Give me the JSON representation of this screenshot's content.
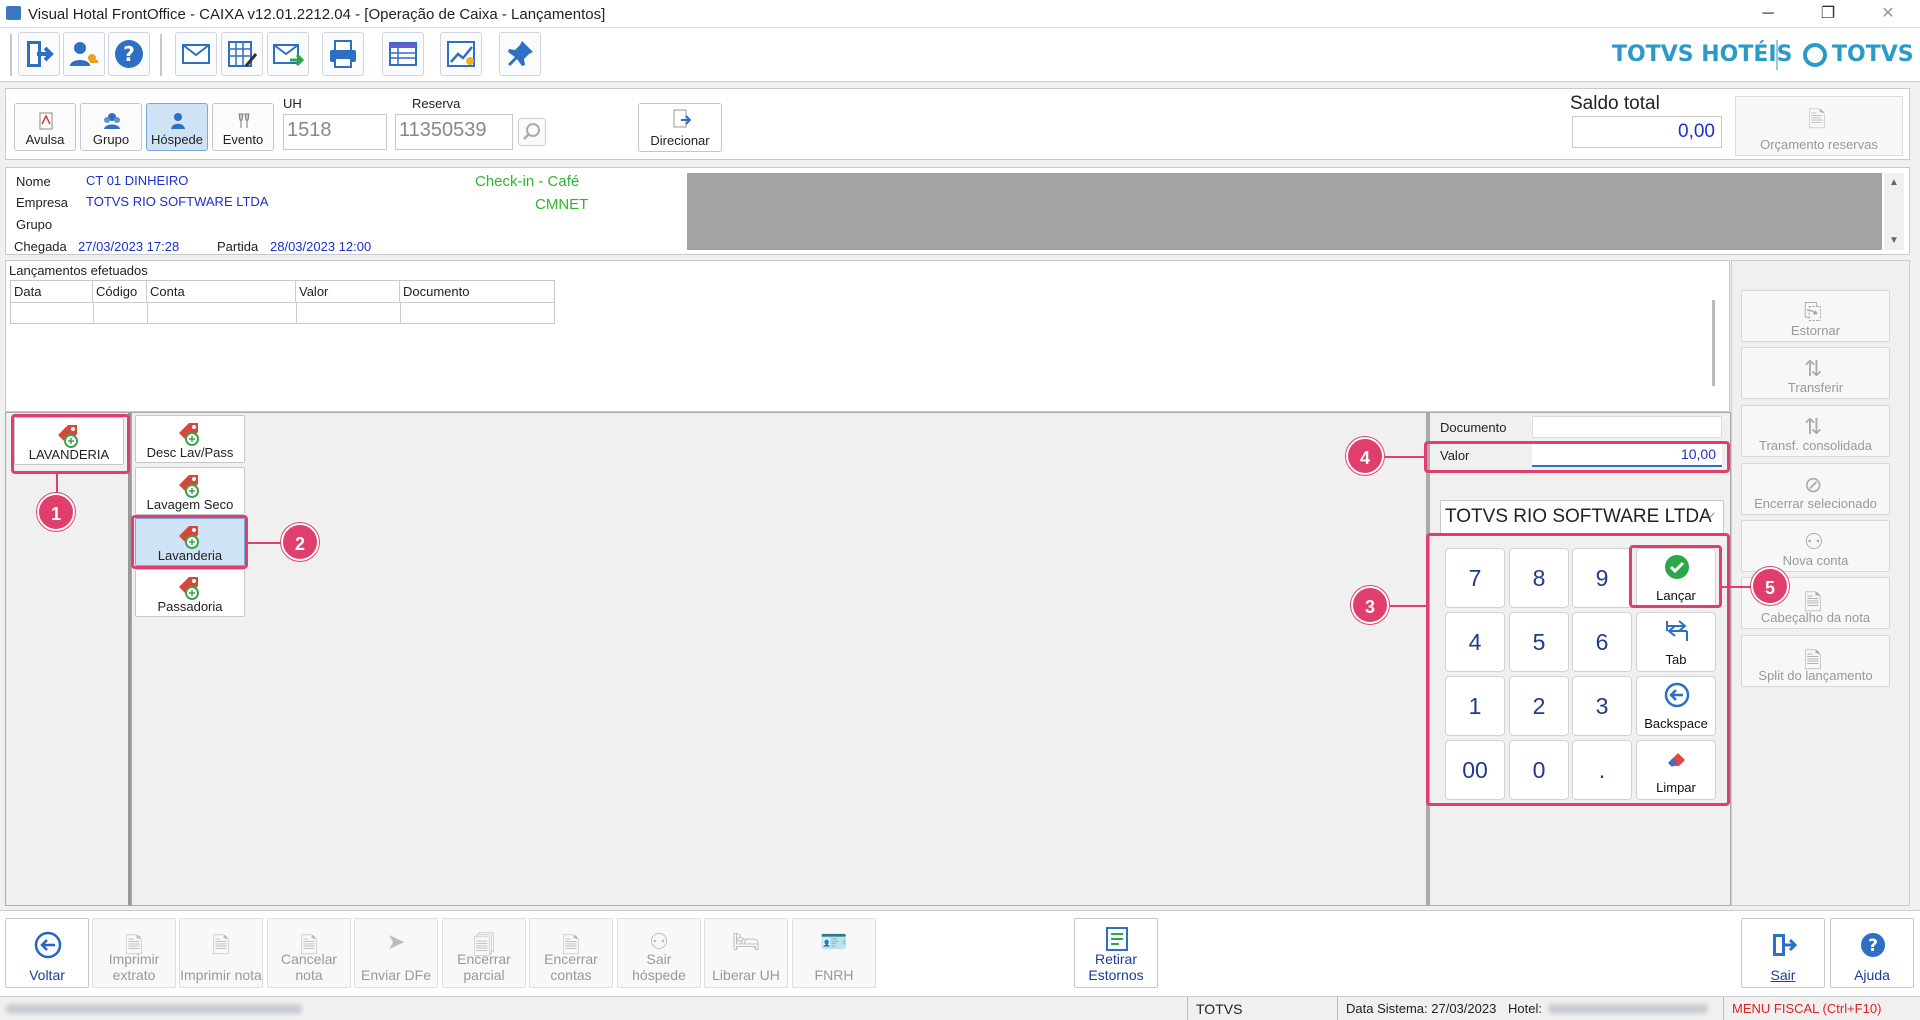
{
  "window": {
    "title": "Visual Hotal FrontOffice - CAIXA v12.01.2212.04 - [Operação de Caixa - Lançamentos]",
    "controls": {
      "minimize": "─",
      "restore": "❐",
      "close": "✕"
    }
  },
  "toolbar": {
    "icons": [
      "exit-icon",
      "user-icon",
      "help-icon",
      "mail-icon",
      "calendar-edit-icon",
      "mail-forward-icon",
      "printer-icon",
      "table-icon",
      "chart-icon",
      "pin-icon"
    ],
    "brand_hotels": "TOTVS HOTÉIS",
    "brand_totvs": "TOTVS"
  },
  "header": {
    "types": [
      {
        "label": "Avulsa",
        "icon": "document-icon",
        "active": false
      },
      {
        "label": "Grupo",
        "icon": "group-icon",
        "active": false
      },
      {
        "label": "Hóspede",
        "icon": "guest-icon",
        "active": true
      },
      {
        "label": "Evento",
        "icon": "event-icon",
        "active": false
      }
    ],
    "uh_label": "UH",
    "uh_value": "1518",
    "reserva_label": "Reserva",
    "reserva_value": "11350539",
    "direcionar_label": "Direcionar",
    "saldo_label": "Saldo total",
    "saldo_value": "0,00",
    "orcamento_label": "Orçamento reservas"
  },
  "guest": {
    "nome_label": "Nome",
    "nome_value": "CT 01 DINHEIRO",
    "empresa_label": "Empresa",
    "empresa_value": "TOTVS RIO SOFTWARE LTDA",
    "grupo_label": "Grupo",
    "chegada_label": "Chegada",
    "chegada_value": "27/03/2023 17:28",
    "partida_label": "Partida",
    "partida_value": "28/03/2023 12:00",
    "checkin_text": "Check-in -  Café",
    "cmnet_text": "CMNET"
  },
  "lancamentos": {
    "title": "Lançamentos efetuados",
    "columns": [
      "Data",
      "Código",
      "Conta",
      "Valor",
      "Documento"
    ]
  },
  "side_actions": [
    {
      "label": "Estornar",
      "icon": "reverse-icon"
    },
    {
      "label": "Transferir",
      "icon": "transfer-icon"
    },
    {
      "label": "Transf. consolidada",
      "icon": "transfer-consolidated-icon"
    },
    {
      "label": "Encerrar selecionado",
      "icon": "close-selected-icon"
    },
    {
      "label": "Nova conta",
      "icon": "new-account-icon"
    },
    {
      "label": "Cabeçalho da nota",
      "icon": "note-header-icon"
    },
    {
      "label": "Split do lançamento",
      "icon": "split-icon"
    }
  ],
  "groups": [
    {
      "label": "LAVANDERIA",
      "icon": "laundry-tag-icon"
    }
  ],
  "items": [
    {
      "label": "Desc Lav/Pass",
      "icon": "laundry-tag-icon",
      "selected": false
    },
    {
      "label": "Lavagem Seco",
      "icon": "laundry-tag-icon",
      "selected": false
    },
    {
      "label": "Lavanderia",
      "icon": "laundry-tag-icon",
      "selected": true
    },
    {
      "label": "Passadoria",
      "icon": "laundry-tag-icon",
      "selected": false
    }
  ],
  "entry": {
    "documento_label": "Documento",
    "documento_value": "",
    "valor_label": "Valor",
    "valor_value": "10,00",
    "empresa_select": "TOTVS RIO SOFTWARE LTDA"
  },
  "numpad": {
    "keys": [
      "7",
      "8",
      "9",
      "4",
      "5",
      "6",
      "1",
      "2",
      "3",
      "00",
      "0",
      "."
    ],
    "lancar": "Lançar",
    "tab": "Tab",
    "backspace": "Backspace",
    "limpar": "Limpar"
  },
  "callouts": [
    "1",
    "2",
    "3",
    "4",
    "5"
  ],
  "bottom": {
    "voltar": "Voltar",
    "actions": [
      {
        "label": "Imprimir extrato",
        "icon": "print-statement-icon"
      },
      {
        "label": "Imprimir nota",
        "icon": "print-note-icon"
      },
      {
        "label": "Cancelar nota",
        "icon": "cancel-note-icon"
      },
      {
        "label": "Enviar DFe",
        "icon": "send-icon"
      },
      {
        "label": "Encerrar parcial",
        "icon": "close-partial-icon"
      },
      {
        "label": "Encerrar contas",
        "icon": "close-accounts-icon"
      },
      {
        "label": "Sair hóspede",
        "icon": "guest-exit-icon"
      },
      {
        "label": "Liberar UH",
        "icon": "bed-icon"
      },
      {
        "label": "FNRH",
        "icon": "id-card-icon"
      }
    ],
    "retirar": "Retirar Estornos",
    "sair": "Sair",
    "ajuda": "Ajuda"
  },
  "status": {
    "user": "TOTVS",
    "data_sistema": "Data Sistema: 27/03/2023",
    "hotel_label": "Hotel:",
    "menu_fiscal": "MENU FISCAL (Ctrl+F10)"
  }
}
